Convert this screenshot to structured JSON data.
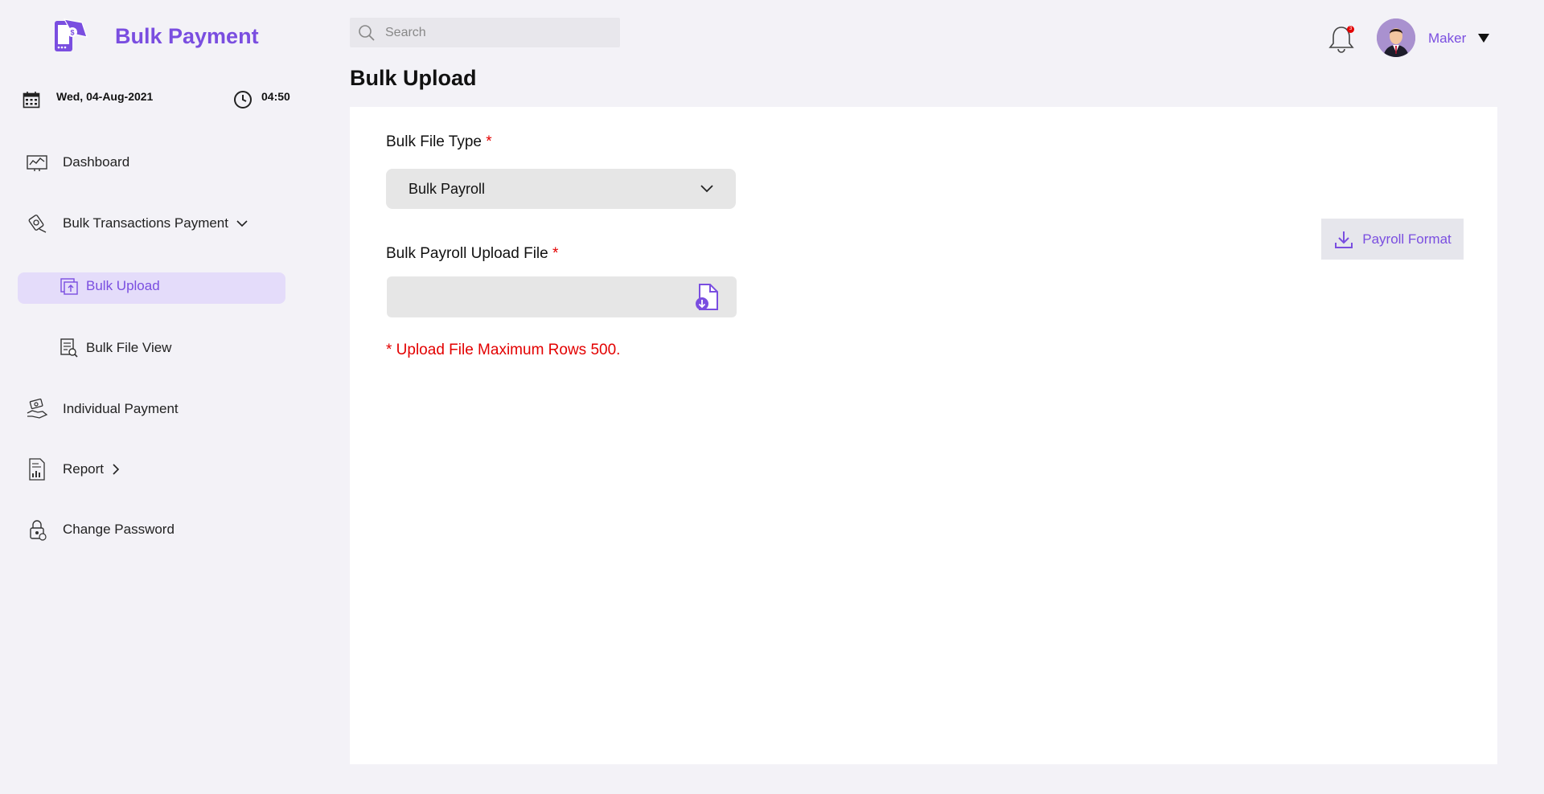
{
  "brand": {
    "title": "Bulk Payment",
    "logo_icon": "mobile-payment-icon"
  },
  "datetime": {
    "date": "Wed, 04-Aug-2021",
    "time": "04:50"
  },
  "sidebar": {
    "items": [
      {
        "label": "Dashboard",
        "icon": "dashboard-icon"
      },
      {
        "label": "Bulk Transactions Payment",
        "icon": "transactions-icon",
        "chevron": "chevron-down-icon"
      },
      {
        "label": "Bulk Upload",
        "icon": "upload-icon",
        "active": true
      },
      {
        "label": "Bulk File View",
        "icon": "file-search-icon"
      },
      {
        "label": "Individual Payment",
        "icon": "hand-money-icon"
      },
      {
        "label": "Report",
        "icon": "report-icon",
        "chevron": "chevron-right-icon"
      },
      {
        "label": "Change Password",
        "icon": "lock-icon"
      }
    ]
  },
  "header": {
    "search_placeholder": "Search",
    "notification_count": "3",
    "user_name": "Maker"
  },
  "page": {
    "title": "Bulk Upload"
  },
  "form": {
    "file_type_label": "Bulk File Type",
    "required_mark": "*",
    "file_type_value": "Bulk Payroll",
    "upload_label": "Bulk Payroll Upload File",
    "warning": "* Upload File Maximum Rows 500.",
    "payroll_format_button": "Payroll Format"
  },
  "colors": {
    "accent": "#7a4ee0",
    "error": "#e30000",
    "active_bg": "#e4dcfa",
    "background": "#f3f2f7"
  }
}
